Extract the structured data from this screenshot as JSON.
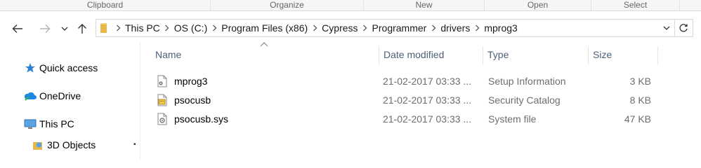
{
  "ribbon": {
    "groups": [
      "Clipboard",
      "Organize",
      "New",
      "Open",
      "Select"
    ]
  },
  "nav": {
    "back_icon": "arrow-left-icon",
    "forward_icon": "arrow-right-icon",
    "recent_icon": "chevron-down-icon",
    "up_icon": "arrow-up-icon"
  },
  "address": {
    "crumbs": [
      "This PC",
      "OS (C:)",
      "Program Files (x86)",
      "Cypress",
      "Programmer",
      "drivers",
      "mprog3"
    ]
  },
  "sidebar": {
    "items": [
      {
        "label": "Quick access",
        "icon": "star-icon"
      },
      {
        "label": "OneDrive",
        "icon": "cloud-icon"
      },
      {
        "label": "This PC",
        "icon": "computer-icon"
      },
      {
        "label": "3D Objects",
        "icon": "cube-folder-icon"
      }
    ]
  },
  "columns": {
    "name": "Name",
    "date": "Date modified",
    "type": "Type",
    "size": "Size"
  },
  "files": [
    {
      "name": "mprog3",
      "date": "21-02-2017 03:33 ...",
      "type": "Setup Information",
      "size": "3 KB",
      "icon": "setup-info-file-icon"
    },
    {
      "name": "psocusb",
      "date": "21-02-2017 03:33 ...",
      "type": "Security Catalog",
      "size": "8 KB",
      "icon": "security-catalog-file-icon"
    },
    {
      "name": "psocusb.sys",
      "date": "21-02-2017 03:33 ...",
      "type": "System file",
      "size": "47 KB",
      "icon": "system-file-icon"
    }
  ],
  "colors": {
    "header_text": "#4c607a",
    "detail_text": "#6d6d6d",
    "folder_yellow": "#e8b84a"
  }
}
